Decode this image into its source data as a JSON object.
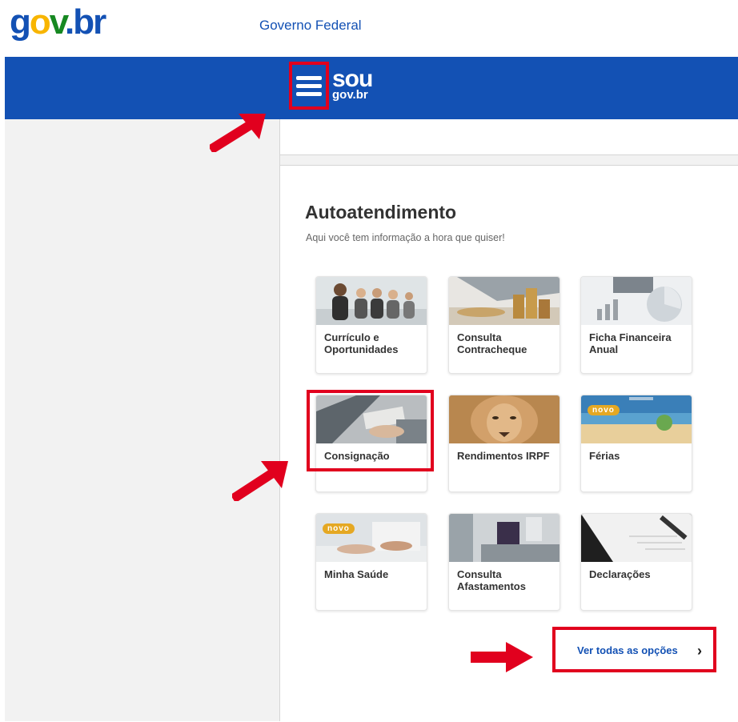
{
  "header": {
    "logo": {
      "g": "g",
      "o": "o",
      "v": "v",
      "dot": ".",
      "br": "br"
    },
    "federal_label": "Governo Federal"
  },
  "topbar": {
    "menu_icon": "hamburger-menu-icon",
    "brand_top": "sou",
    "brand_bottom": "gov.br"
  },
  "main": {
    "title": "Autoatendimento",
    "subtitle": "Aqui você tem informação a hora que quiser!",
    "badge_label": "novo",
    "cards": [
      {
        "label": "Currículo e Oportunidades"
      },
      {
        "label": "Consulta Contracheque"
      },
      {
        "label": "Ficha Financeira Anual"
      },
      {
        "label": "Consignação"
      },
      {
        "label": "Rendimentos IRPF"
      },
      {
        "label": "Férias"
      },
      {
        "label": "Minha Saúde"
      },
      {
        "label": "Consulta Afastamentos"
      },
      {
        "label": "Declarações"
      }
    ],
    "see_all": "Ver todas as opções",
    "see_all_icon": "chevron-right-icon"
  },
  "colors": {
    "brand_blue": "#1351b4",
    "highlight_red": "#e1001e",
    "badge": "#e5a823"
  }
}
